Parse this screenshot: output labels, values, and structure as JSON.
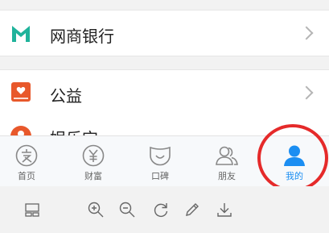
{
  "list": {
    "items": [
      {
        "label": "网商银行",
        "icon": "mybank-logo-icon",
        "color": "#1fb39b"
      },
      {
        "label": "公益",
        "icon": "charity-book-icon",
        "color": "#e8582b"
      },
      {
        "label": "娱乐宝",
        "icon": "entertainment-icon",
        "color": "#e8582b"
      }
    ]
  },
  "tabbar": {
    "tabs": [
      {
        "label": "首页",
        "icon": "home-zhi-icon"
      },
      {
        "label": "财富",
        "icon": "wealth-yen-icon"
      },
      {
        "label": "口碑",
        "icon": "koubei-smile-icon"
      },
      {
        "label": "朋友",
        "icon": "friends-icon"
      },
      {
        "label": "我的",
        "icon": "person-icon",
        "active": true
      }
    ],
    "active_color": "#1b8ef2",
    "inactive_color": "#888888"
  },
  "annotation": {
    "color": "#e52a2a",
    "shape": "circle around 我的 tab"
  },
  "viewer_toolbar": {
    "tools": [
      "thumbnail-icon",
      "zoom-in-icon",
      "zoom-out-icon",
      "rotate-icon",
      "edit-pen-icon",
      "download-icon"
    ]
  }
}
